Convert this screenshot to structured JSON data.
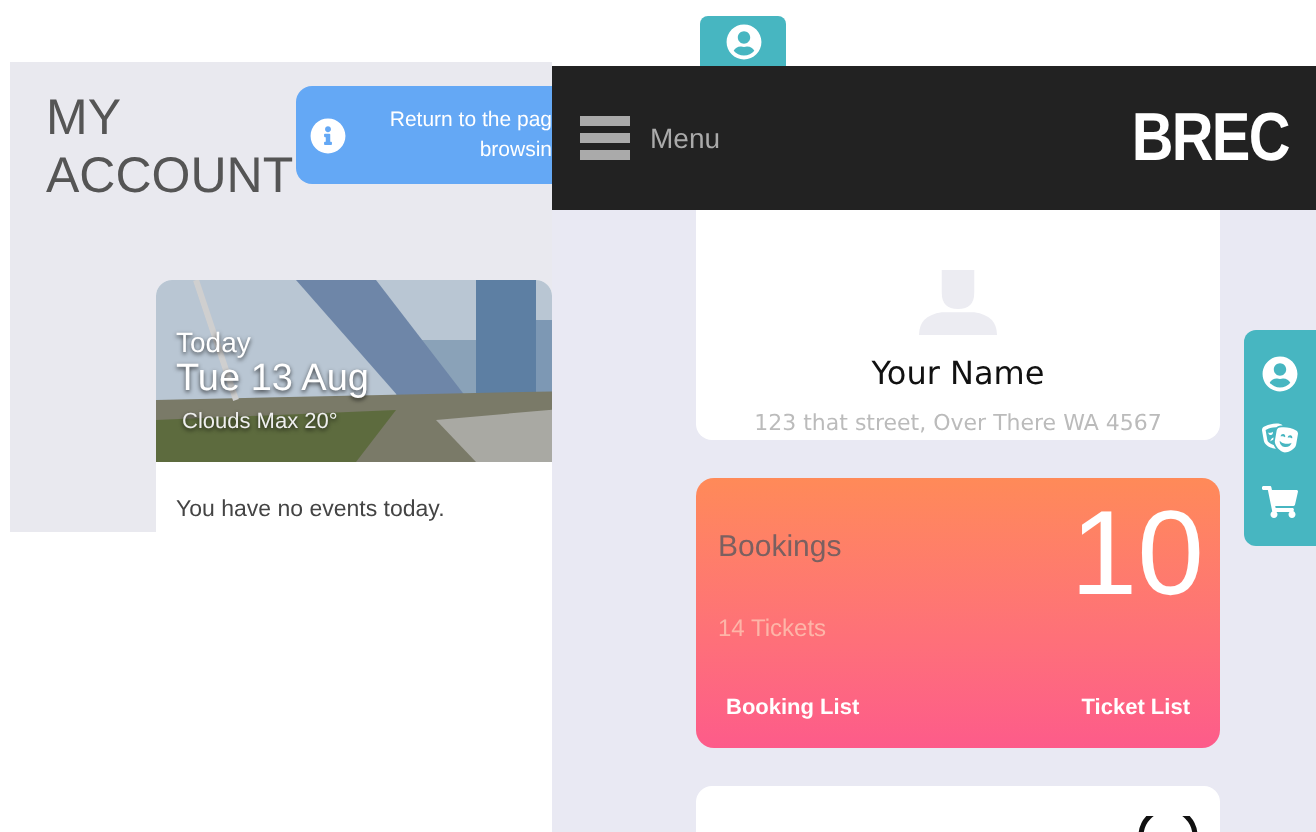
{
  "account": {
    "title_lines": [
      "MY",
      "ACCOUNT"
    ],
    "banner_lines": [
      "Return to the pag",
      "browsin"
    ],
    "day_card": {
      "label": "Today",
      "date": "Tue 13 Aug",
      "weather": "Clouds Max 20°",
      "message": "You have no events today."
    }
  },
  "header": {
    "menu_label": "Menu",
    "logo": "BREC"
  },
  "profile": {
    "name": "Your Name",
    "address": "123 that street, Over There WA 4567"
  },
  "side_tabs": [
    {
      "kind": "user"
    },
    {
      "kind": "masks"
    },
    {
      "kind": "cart"
    }
  ],
  "bookings": {
    "title": "Bookings",
    "count": "10",
    "tickets": "14 Tickets",
    "links": [
      "Booking List",
      "Ticket List"
    ]
  }
}
